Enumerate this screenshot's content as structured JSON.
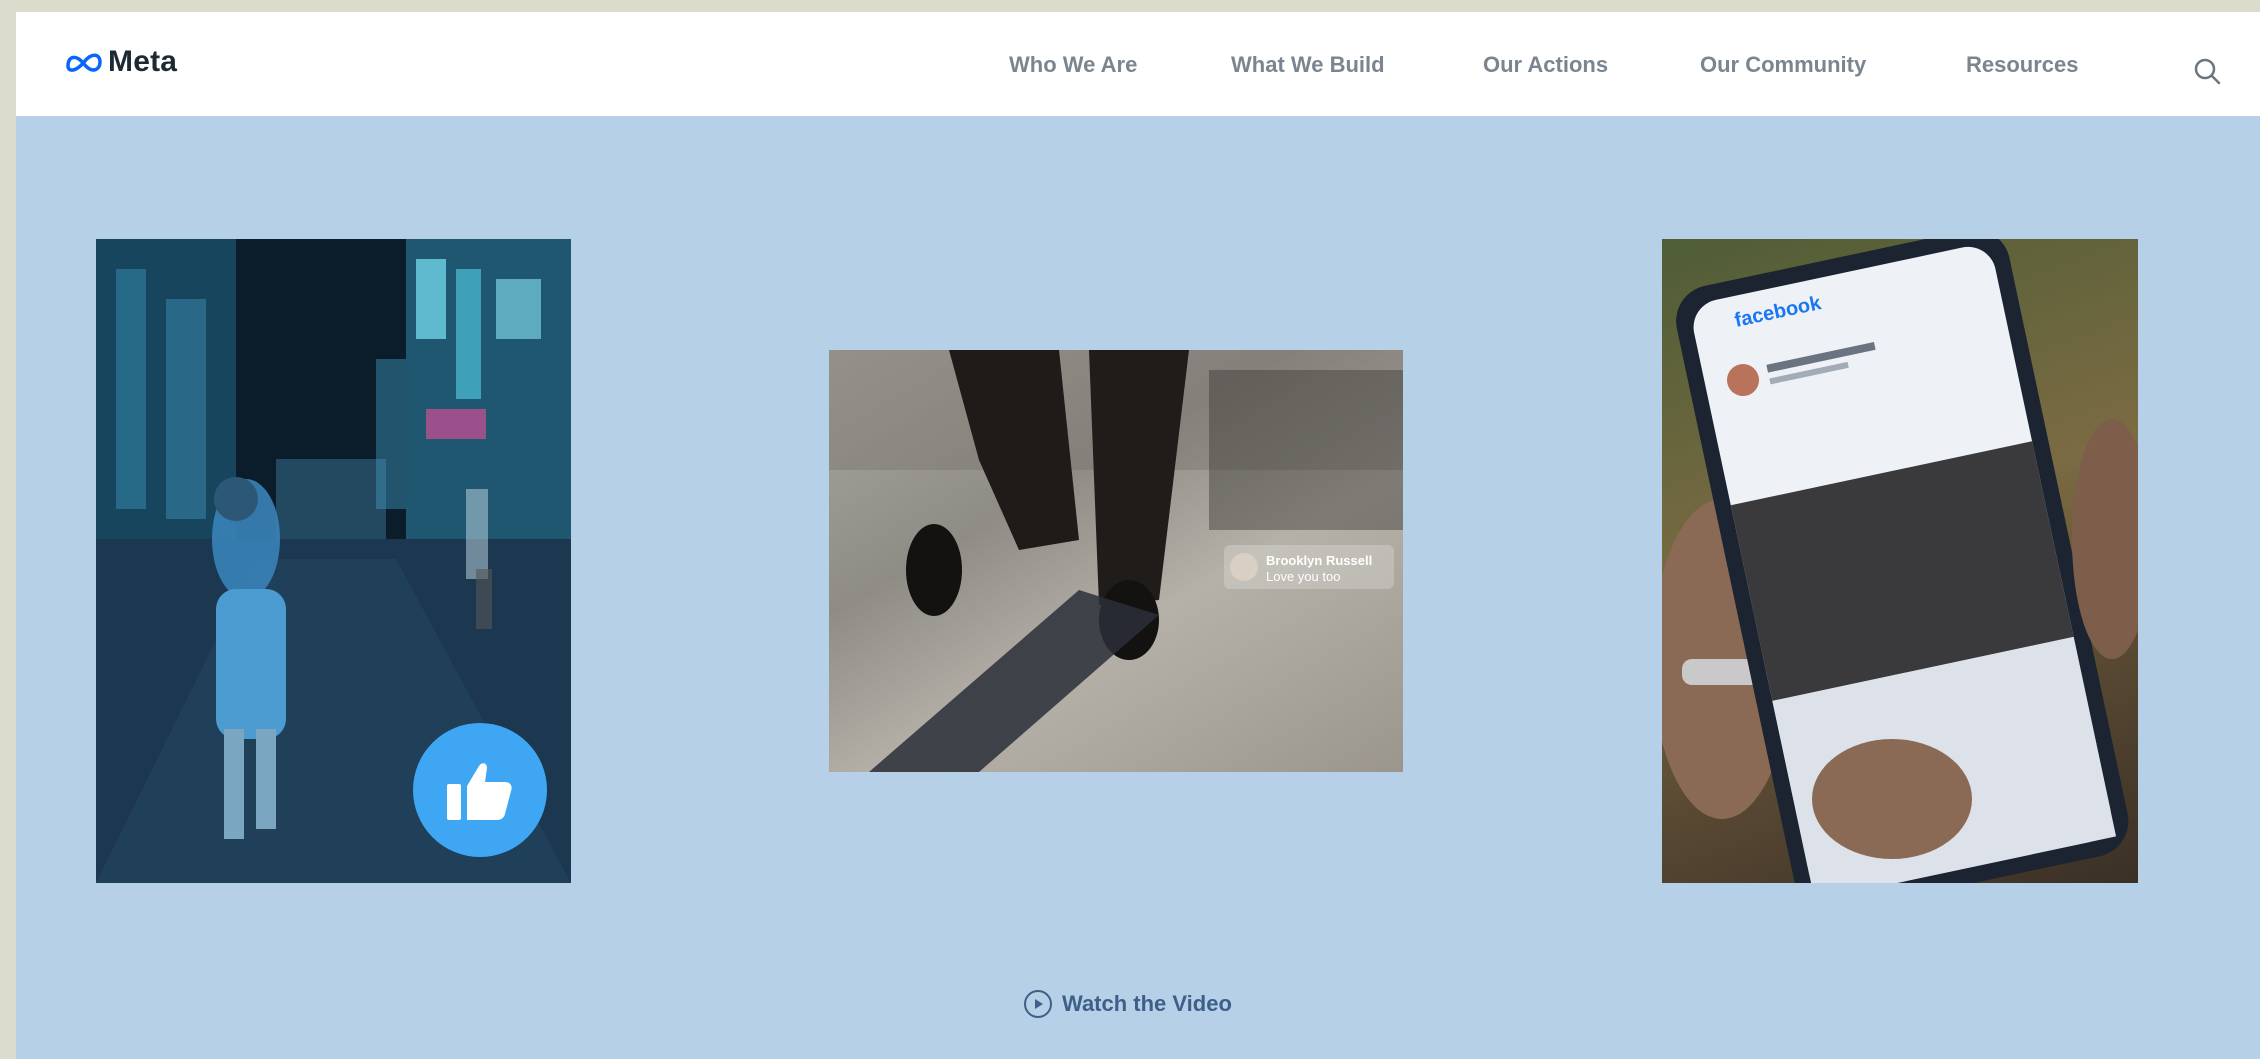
{
  "header": {
    "brand": "Meta",
    "nav": [
      {
        "label": "Who We Are"
      },
      {
        "label": "What We Build"
      },
      {
        "label": "Our Actions"
      },
      {
        "label": "Our Community"
      },
      {
        "label": "Resources"
      }
    ],
    "search_icon": "search-icon"
  },
  "hero": {
    "left_image": {
      "description_icon": "like-thumb-icon"
    },
    "middle_image": {
      "overlay_name": "Brooklyn Russell",
      "overlay_sub": "Love you too"
    },
    "right_image": {
      "app_name": "facebook"
    },
    "cta": {
      "label": "Watch the Video",
      "icon": "play-icon"
    }
  },
  "colors": {
    "page_bg": "#b6d0e8",
    "outer_bg": "#dcdccd",
    "nav_text": "#7b8590",
    "like_blue": "#3ea6f3",
    "cta_text": "#3e5f88"
  }
}
